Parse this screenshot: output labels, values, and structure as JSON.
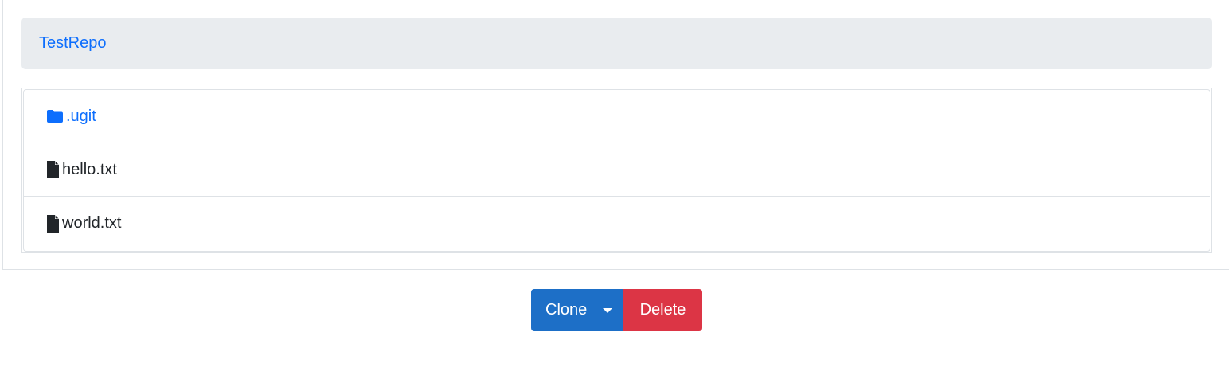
{
  "breadcrumb": {
    "repo_name": "TestRepo"
  },
  "files": [
    {
      "name": ".ugit",
      "type": "folder",
      "icon": "folder-icon",
      "color": "#0d6efd"
    },
    {
      "name": "hello.txt",
      "type": "file",
      "icon": "file-icon",
      "color": "#212529"
    },
    {
      "name": "world.txt",
      "type": "file",
      "icon": "file-icon",
      "color": "#212529"
    }
  ],
  "actions": {
    "clone_label": "Clone",
    "delete_label": "Delete",
    "clone_color": "#1d6fc7",
    "delete_color": "#dc3545"
  }
}
